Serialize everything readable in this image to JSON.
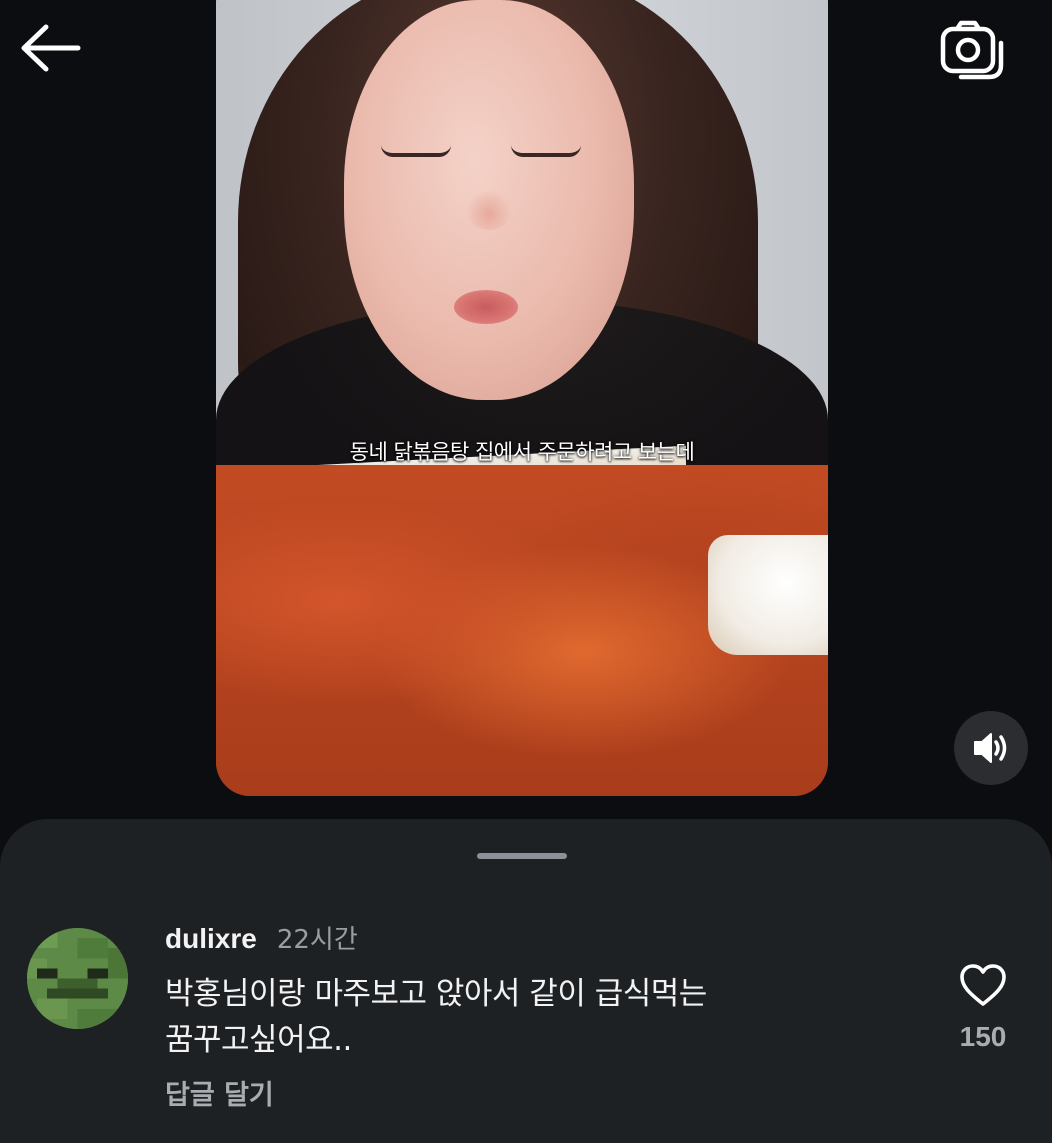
{
  "top_bar": {
    "back_icon": "arrow-left-icon",
    "camera_icon": "camera-flip-icon"
  },
  "video": {
    "subtitle": "동네 닭볶음탕 집에서 주문하려고 보는데",
    "sound_icon": "speaker-volume-icon"
  },
  "comments": {
    "items": [
      {
        "username": "dulixre",
        "time": "22시간",
        "text_line1": "박홍님이랑 마주보고 앉아서 같이 급식먹는",
        "text_line2": "꿈꾸고싶어요..",
        "reply_label": "답글 달기",
        "like_icon": "heart-outline-icon",
        "like_count": "150"
      }
    ]
  },
  "colors": {
    "background": "#0b0d10",
    "sheet": "#1e2124",
    "muted_text": "#9a9da2"
  }
}
